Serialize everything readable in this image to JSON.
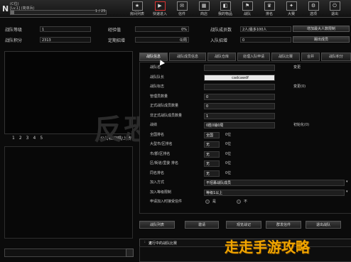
{
  "topbar": {
    "logo_letter": "N",
    "level_text": "(C位)",
    "user_text": "[Lv.1] (简单兵)",
    "progress_text": "1 / 25",
    "level_progress_percent": 4,
    "nav": [
      {
        "icon": "★",
        "label": "房间列表",
        "icon_name": "room-list-icon"
      },
      {
        "icon": "▶",
        "label": "快速进入",
        "icon_name": "quick-join-icon"
      },
      {
        "icon": "✉",
        "label": "信件",
        "icon_name": "mail-icon"
      },
      {
        "icon": "▦",
        "label": "商店",
        "icon_name": "shop-icon"
      },
      {
        "icon": "◧",
        "label": "我的物品",
        "icon_name": "inventory-icon"
      },
      {
        "icon": "⚑",
        "label": "战队",
        "icon_name": "clan-icon"
      },
      {
        "icon": "♛",
        "label": "排名",
        "icon_name": "ranking-icon"
      },
      {
        "icon": "✦",
        "label": "大赛",
        "icon_name": "tournament-icon"
      },
      {
        "icon": "⚙",
        "label": "选项",
        "icon_name": "options-icon"
      },
      {
        "icon": "⏻",
        "label": "退出",
        "icon_name": "exit-icon"
      }
    ]
  },
  "stats": {
    "clan_level_label": "战队等级",
    "clan_level_value": "1",
    "exp_label": "经验值",
    "exp_value": "0%",
    "member_count_label": "战队成员数",
    "member_count_value": "2人/最多100人",
    "increase_member_button": "增加最大人数限制",
    "clan_points_label": "战队积分",
    "clan_points_value": "2313",
    "fixed_invite_label": "定期招增",
    "fixed_invite_value": "0/周",
    "join_invite_label": "入队招增",
    "join_invite_value": "0",
    "kick_label": "踢出成员"
  },
  "left": {
    "pages": [
      "1",
      "2",
      "3",
      "4",
      "5"
    ],
    "upload_label": "公告栏编辑/上传"
  },
  "tabs": [
    "战队信息",
    "战队成员信息",
    "战队仓库",
    "处理入队申请",
    "战队比赛",
    "合并",
    "战队积分"
  ],
  "form": {
    "rows": [
      {
        "label": "战队名",
        "value": "",
        "button": "变更"
      },
      {
        "label": "战队队长",
        "value": "cadcawdf",
        "button": ""
      },
      {
        "label": "战队标志",
        "value": "",
        "button": "变更(0)"
      },
      {
        "label": "管理员数量",
        "value": "0",
        "button": ""
      },
      {
        "label": "正式战队成员数量",
        "value": "0",
        "button": ""
      },
      {
        "label": "非正式战队成员数量",
        "value": "1",
        "button": ""
      },
      {
        "label": "战绩",
        "value": "0胜0输0局",
        "button": "初始化(0)"
      },
      {
        "label": "全国排名",
        "value": "全国",
        "value2": "0位",
        "button": ""
      },
      {
        "label": "大型市/区排名",
        "value": "无",
        "value2": "0位",
        "button": ""
      },
      {
        "label": "市/郡/区排名",
        "value": "无",
        "value2": "0位",
        "button": ""
      },
      {
        "label": "区/街道/里委 排名",
        "value": "无",
        "value2": "0位",
        "button": ""
      },
      {
        "label": "同名排名",
        "value": "无",
        "value2": "0位",
        "button": ""
      },
      {
        "label": "加入方式",
        "value": "不招募战队成员",
        "button": ""
      },
      {
        "label": "加入等级限制",
        "value": "等级1以上",
        "button": ""
      },
      {
        "label": "申请加入时接受信件",
        "value": "",
        "radio_yes": "是",
        "radio_no": "不"
      }
    ]
  },
  "bottom_buttons": [
    "战队列表",
    "邀请",
    "观览战记",
    "群发信件",
    "退出战队"
  ],
  "compete": {
    "label": "进行中的战队比赛",
    "value": "无"
  },
  "watermark": "走走手游攻略",
  "background_text": "反恐精英"
}
